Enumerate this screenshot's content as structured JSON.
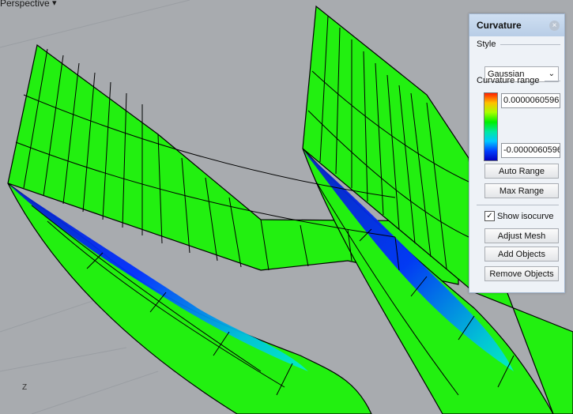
{
  "viewport": {
    "label": "Perspective",
    "menu_arrow": "▾",
    "axis_label": "Z"
  },
  "panel": {
    "title": "Curvature",
    "close_icon": "×",
    "style_label": "Style",
    "style_value": "Gaussian",
    "range_label": "Curvature range",
    "range_max": "0.0000060596",
    "range_min": "-0.0000060596",
    "auto_range": "Auto Range",
    "max_range": "Max Range",
    "show_isocurve": "Show isocurve",
    "show_isocurve_checked": "✓",
    "adjust_mesh": "Adjust Mesh",
    "add_objects": "Add Objects",
    "remove_objects": "Remove Objects"
  },
  "colors": {
    "surface_green": "#22f010",
    "surface_blue": "#1030e0",
    "surface_cyan": "#00f0d0",
    "background": "#a8abaf"
  }
}
